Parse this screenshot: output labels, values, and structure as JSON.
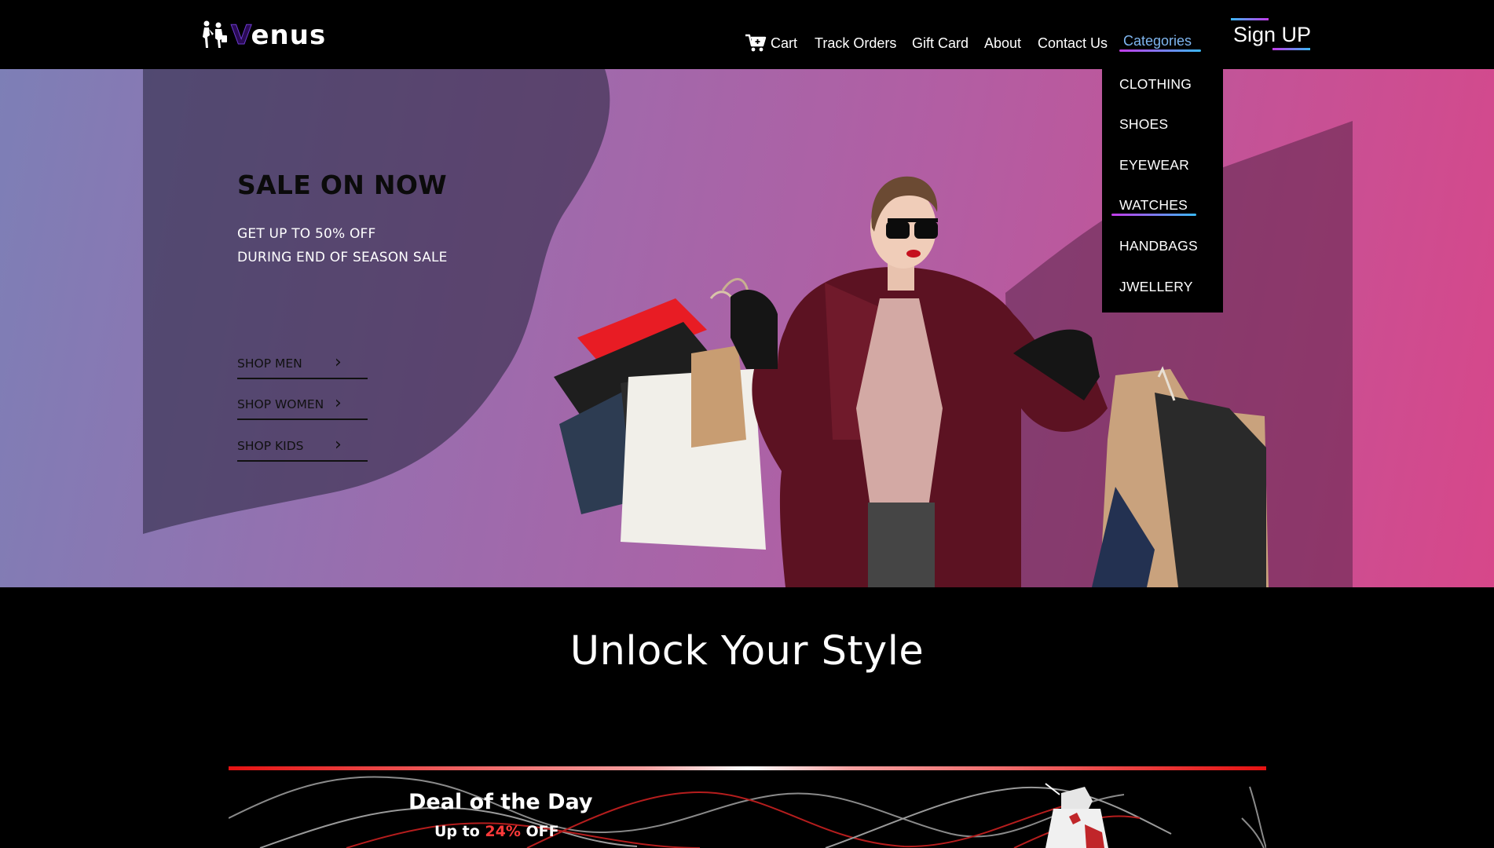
{
  "brand": {
    "name_first": "V",
    "name_rest": "enus"
  },
  "nav": {
    "items": [
      "Cart",
      "Track Orders",
      "Gift Card",
      "About",
      "Contact Us",
      "Categories"
    ],
    "signup": "Sign UP"
  },
  "categories": [
    "CLOTHING",
    "SHOES",
    "EYEWEAR",
    "WATCHES",
    "HANDBAGS",
    "JWELLERY"
  ],
  "hero": {
    "title": "SALE ON NOW",
    "line1": "GET UP TO 50% OFF",
    "line2": "DURING END OF SEASON SALE",
    "links": [
      "SHOP MEN",
      "SHOP WOMEN",
      "SHOP KIDS"
    ]
  },
  "section": {
    "title": "Unlock Your Style",
    "deal_title": "Deal of the Day",
    "deal_prefix": "Up to",
    "deal_percent": "24%",
    "deal_suffix": "OFF"
  },
  "colors": {
    "accent_gradient_a": "#c23be8",
    "accent_gradient_b": "#3ab8f5",
    "deal_red": "#e61212"
  }
}
